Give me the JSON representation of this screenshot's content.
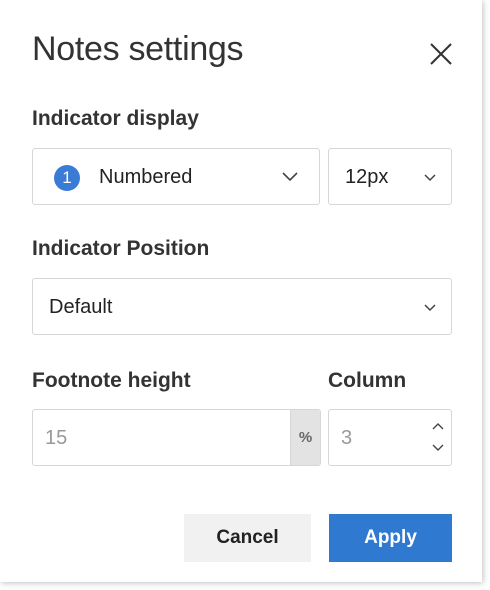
{
  "dialog": {
    "title": "Notes settings"
  },
  "indicator_display": {
    "label": "Indicator display",
    "style_badge": "1",
    "style_value": "Numbered",
    "size_value": "12px"
  },
  "indicator_position": {
    "label": "Indicator Position",
    "value": "Default"
  },
  "footnote_height": {
    "label": "Footnote height",
    "value": "15",
    "unit": "%"
  },
  "column": {
    "label": "Column",
    "value": "3"
  },
  "buttons": {
    "cancel_label": "Cancel",
    "apply_label": "Apply"
  },
  "colors": {
    "accent": "#2f79d1",
    "badge": "#3a7bd5"
  },
  "icons": {
    "close": "close-icon",
    "dropdown": "chevron-down-icon",
    "stepper_up": "chevron-up-icon",
    "stepper_down": "chevron-down-icon"
  }
}
